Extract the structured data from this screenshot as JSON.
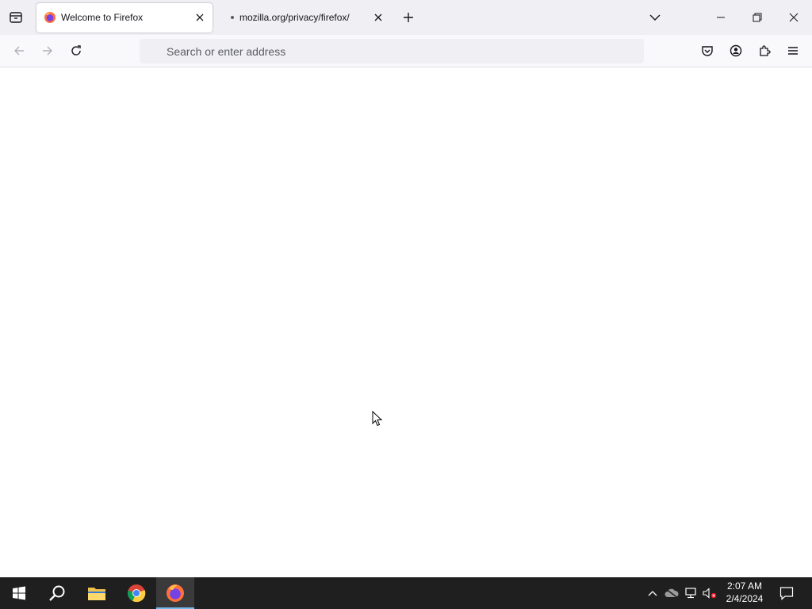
{
  "window": {
    "tabs": [
      {
        "title": "Welcome to Firefox",
        "active": true
      },
      {
        "title": "mozilla.org/privacy/firefox/",
        "active": false
      }
    ]
  },
  "toolbar": {
    "address_placeholder": "Search or enter address",
    "address_value": ""
  },
  "taskbar": {
    "apps": [
      "start-icon",
      "search-icon",
      "file-explorer-icon",
      "chrome-icon",
      "firefox-icon"
    ],
    "clock_time": "2:07 AM",
    "clock_date": "2/4/2024"
  },
  "colors": {
    "tabstrip_bg": "#f0f0f4",
    "toolbar_bg": "#f9f9fb",
    "taskbar_bg": "#1f1f1f",
    "taskbar_active_indicator": "#76b9ed"
  }
}
